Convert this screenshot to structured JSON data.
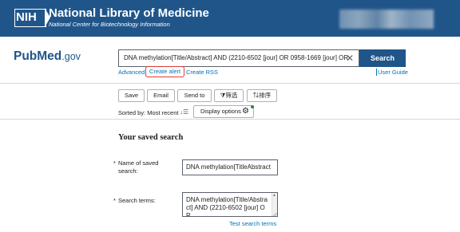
{
  "nih_header": {
    "logo_text": "NIH",
    "title": "National Library of Medicine",
    "subtitle": "National Center for Biotechnology Information"
  },
  "pubmed_header": {
    "logo_main": "PubMed",
    "logo_suffix": ".gov",
    "search_value": "DNA methylation[Title/Abstract] AND (2210-6502 [jour] OR 0958-1669 [jour] OR",
    "clear_symbol": "✕",
    "search_button": "Search",
    "links": {
      "advanced": "Advanced",
      "create_alert": "Create alert",
      "create_rss": "Create RSS",
      "user_guide": "User Guide"
    }
  },
  "toolbar": {
    "save": "Save",
    "email": "Email",
    "send_to": "Send to",
    "filter": "⧩筛选",
    "sort": "⇅排序",
    "sorted_by": "Sorted by: Most recent",
    "sort_icon": "↓☰",
    "display_options": "Display options",
    "gear_icon_glyph": "⚙"
  },
  "saved_search": {
    "heading": "Your saved search",
    "required_marker": "*",
    "name_label": "Name of saved search:",
    "name_value": "DNA methylation[TitleAbstract",
    "terms_label": "Search terms:",
    "terms_value": "DNA methylation[Title/Abstract] AND (2210-6502 [jour] OR",
    "test_link": "Test search terms"
  },
  "colors": {
    "nih_blue": "#20558a",
    "link_blue": "#0071bc",
    "alert_highlight": "#e03c31",
    "required_red": "#e31c3d"
  }
}
